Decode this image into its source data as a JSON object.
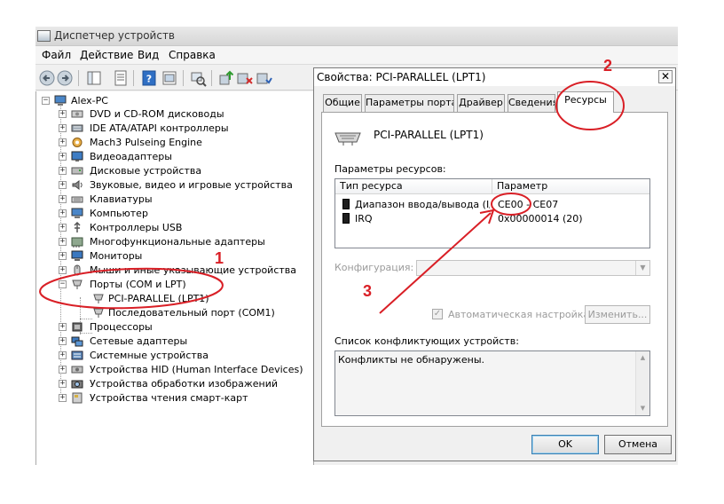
{
  "window": {
    "title": "Диспетчер устройств"
  },
  "menu": [
    "Файл",
    "Действие",
    "Вид",
    "Справка"
  ],
  "toolbar": {
    "buttons": [
      "back-icon",
      "forward-icon",
      "show-hide-console-tree-icon",
      "properties-icon",
      "help-icon",
      "view-icon",
      "scan-hardware-icon",
      "update-driver-icon",
      "disable-device-icon",
      "uninstall-device-icon"
    ]
  },
  "tree": {
    "root": "Alex-PC",
    "items": [
      {
        "label": "DVD и CD-ROM дисководы",
        "icon": "dvd-drive-icon"
      },
      {
        "label": "IDE ATA/ATAPI контроллеры",
        "icon": "ide-controller-icon"
      },
      {
        "label": "Mach3 Pulseing Engine",
        "icon": "mach3-icon"
      },
      {
        "label": "Видеоадаптеры",
        "icon": "display-adapter-icon"
      },
      {
        "label": "Дисковые устройства",
        "icon": "disk-drive-icon"
      },
      {
        "label": "Звуковые, видео и игровые устройства",
        "icon": "sound-icon"
      },
      {
        "label": "Клавиатуры",
        "icon": "keyboard-icon"
      },
      {
        "label": "Компьютер",
        "icon": "computer-icon"
      },
      {
        "label": "Контроллеры USB",
        "icon": "usb-icon"
      },
      {
        "label": "Многофункциональные адаптеры",
        "icon": "multifunction-adapter-icon"
      },
      {
        "label": "Мониторы",
        "icon": "monitor-icon"
      },
      {
        "label": "Мыши и иные указывающие устройства",
        "icon": "mouse-icon"
      },
      {
        "label": "Порты (COM и LPT)",
        "icon": "port-icon",
        "expanded": true,
        "children": [
          {
            "label": "PCI-PARALLEL (LPT1)"
          },
          {
            "label": "Последовательный порт (COM1)"
          }
        ]
      },
      {
        "label": "Процессоры",
        "icon": "processor-icon"
      },
      {
        "label": "Сетевые адаптеры",
        "icon": "network-adapter-icon"
      },
      {
        "label": "Системные устройства",
        "icon": "system-devices-icon"
      },
      {
        "label": "Устройства HID (Human Interface Devices)",
        "icon": "hid-icon"
      },
      {
        "label": "Устройства обработки изображений",
        "icon": "imaging-device-icon"
      },
      {
        "label": "Устройства чтения смарт-карт",
        "icon": "smart-card-reader-icon"
      }
    ]
  },
  "dialog": {
    "title": "Свойства: PCI-PARALLEL (LPT1)",
    "close_label": "✕",
    "tabs": [
      "Общие",
      "Параметры порта",
      "Драйвер",
      "Сведения",
      "Ресурсы"
    ],
    "active_tab": "Ресурсы",
    "device_name": "PCI-PARALLEL (LPT1)",
    "resources_label": "Параметры ресурсов:",
    "columns": [
      "Тип ресурса",
      "Параметр"
    ],
    "rows": [
      {
        "type": "Диапазон ввода/вывода (I/O)",
        "value": "CE00 - CE07"
      },
      {
        "type": "IRQ",
        "value": "0x00000014 (20)"
      }
    ],
    "config_label": "Конфигурация:",
    "auto_setting_label": "Автоматическая настройка",
    "auto_setting_checked": true,
    "change_button": "Изменить...",
    "conflict_label": "Список конфликтующих устройств:",
    "conflict_text": "Конфликты не обнаружены.",
    "ok_button": "OK",
    "cancel_button": "Отмена"
  },
  "annotations": {
    "n1": "1",
    "n2": "2",
    "n3": "3",
    "color": "#d91f26"
  }
}
